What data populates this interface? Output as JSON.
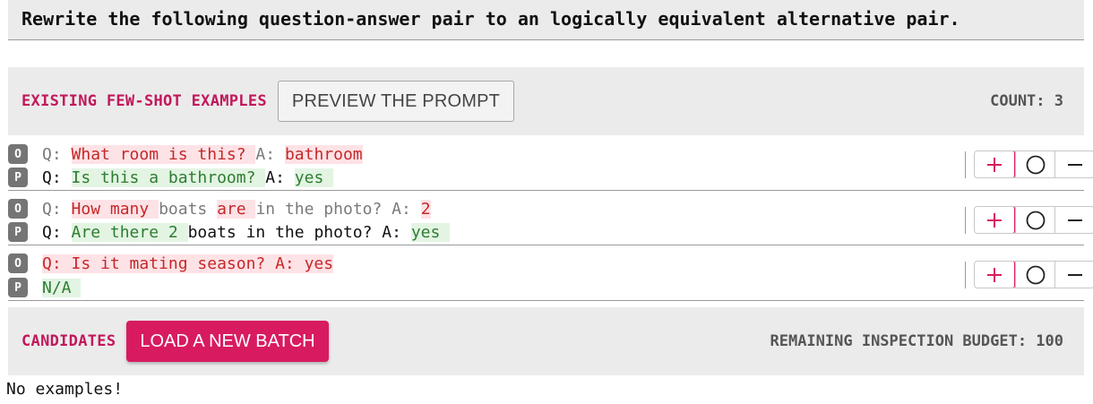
{
  "task": {
    "instruction": "Rewrite the following question-answer pair to an logically equivalent alternative pair."
  },
  "few_shot": {
    "label": "EXISTING FEW-SHOT EXAMPLES",
    "preview_button": "PREVIEW THE PROMPT",
    "count_text": "COUNT: 3",
    "examples": [
      {
        "original": {
          "badge": "O",
          "segments": [
            "Q: ",
            "What room is this? ",
            "A: ",
            "bathroom"
          ]
        },
        "paraphrase": {
          "badge": "P",
          "segments": [
            "Q: ",
            "Is this a bathroom? ",
            "A: ",
            "yes "
          ]
        }
      },
      {
        "original": {
          "badge": "O",
          "segments": [
            "Q: ",
            "How many ",
            "boats ",
            "are ",
            "in the photo? A: ",
            "2"
          ]
        },
        "paraphrase": {
          "badge": "P",
          "segments": [
            "Q: ",
            "Are there 2 ",
            "boats in the photo? A: ",
            "yes "
          ]
        }
      },
      {
        "original": {
          "badge": "O",
          "segments": [
            "Q: Is it mating season? A: yes"
          ]
        },
        "paraphrase": {
          "badge": "P",
          "segments": [
            "N/A "
          ]
        }
      }
    ],
    "controls": {
      "plus": "plus-icon",
      "circle": "circle-icon",
      "minus": "minus-icon",
      "plus_color": "#d81b60"
    }
  },
  "candidates": {
    "label": "CANDIDATES",
    "load_button": "LOAD A NEW BATCH",
    "budget_text": "REMAINING INSPECTION BUDGET: 100",
    "empty_text": "No examples!"
  },
  "colors": {
    "accent": "#d81b60",
    "deleted_bg": "#fde2e6",
    "deleted_text": "#c62828",
    "inserted_bg": "#e3f4e3",
    "inserted_text": "#2e7d32"
  }
}
